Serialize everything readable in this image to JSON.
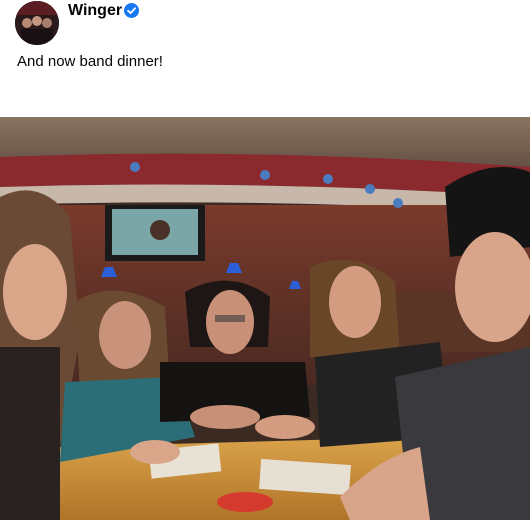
{
  "post": {
    "author": "Winger",
    "verified": true,
    "text": "And now band dinner!",
    "avatar_icon": "band-avatar",
    "verified_icon": "verified-checkmark-icon",
    "photo_icon": "band-dinner-photo"
  },
  "colors": {
    "verified_blue": "#1877f2",
    "text": "#050505"
  }
}
